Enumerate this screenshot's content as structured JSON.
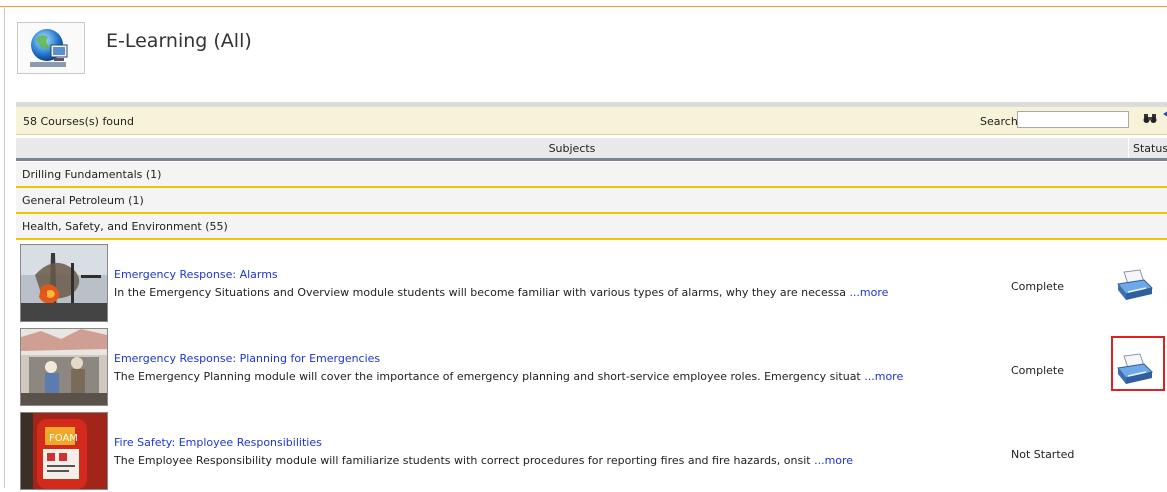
{
  "header": {
    "title": "E-Learning (All)"
  },
  "toolbar": {
    "count_text": "58 Courses(s) found",
    "search_label": "Search:",
    "search_value": ""
  },
  "columns": {
    "subjects": "Subjects",
    "status": "Status"
  },
  "categories": [
    {
      "label": "Drilling Fundamentals (1)"
    },
    {
      "label": "General Petroleum (1)"
    },
    {
      "label": "Health, Safety, and Environment (55)"
    }
  ],
  "courses": [
    {
      "title": "Emergency Response: Alarms",
      "description": "In the Emergency Situations and Overview module students will become familiar with various types of alarms, why they are necessa ",
      "more": "...more",
      "status": "Complete",
      "print_icon": "printer-icon"
    },
    {
      "title": "Emergency Response: Planning for Emergencies",
      "description": "The Emergency Planning module will cover the importance of emergency planning and short-service employee roles. Emergency situat ",
      "more": "...more",
      "status": "Complete",
      "print_icon": "printer-icon"
    },
    {
      "title": "Fire Safety: Employee Responsibilities",
      "description": "The Employee Responsibility module will familiarize students with correct procedures for reporting fires and fire hazards, onsit ",
      "more": "...more",
      "status": "Not Started"
    }
  ],
  "colors": {
    "link": "#1d35d4",
    "toolbar_bg": "#f6f3d8",
    "category_border": "#f2c400",
    "highlight": "#e02020"
  }
}
